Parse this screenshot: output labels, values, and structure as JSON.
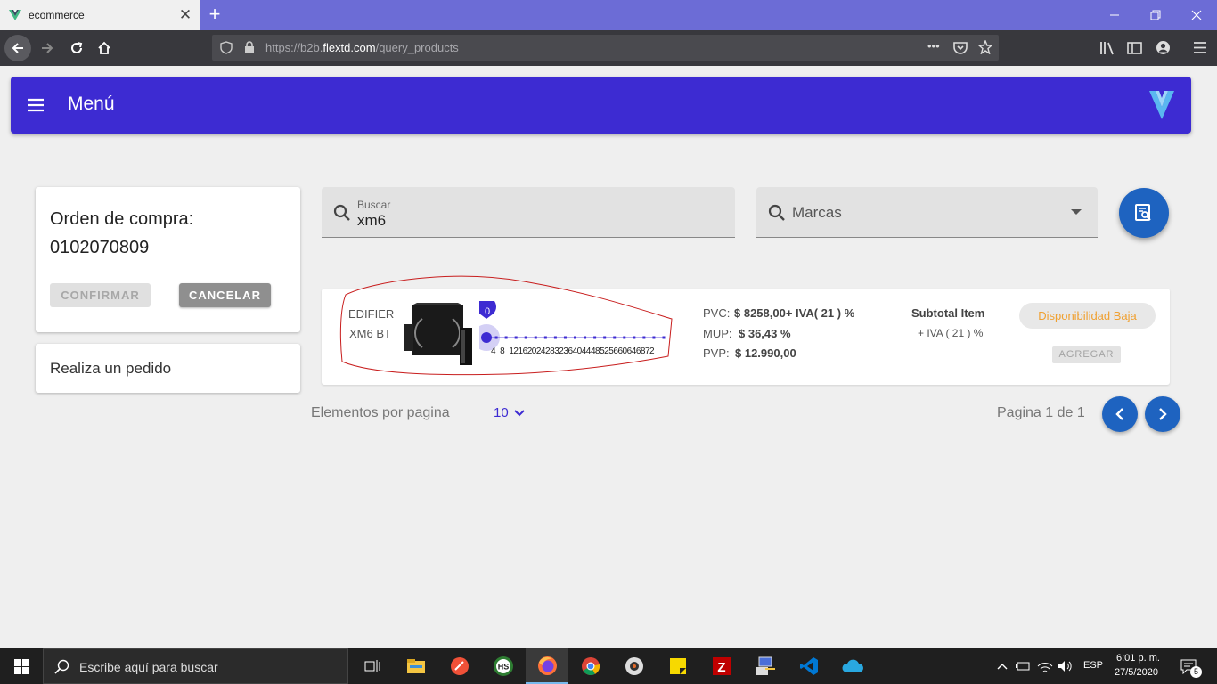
{
  "browser": {
    "tab_title": "ecommerce",
    "tab_close": "✕",
    "new_tab": "+",
    "url_prefix": "https://b2b.",
    "url_domain": "flextd.com",
    "url_path": "/query_products",
    "url_more": "•••"
  },
  "app": {
    "menu_title": "Menú",
    "accent_color": "#3d2bd2",
    "button_blue": "#1e63c0"
  },
  "order": {
    "title_line1": "Orden de compra:",
    "title_line2": "0102070809",
    "confirm_label": "CONFIRMAR",
    "cancel_label": "CANCELAR",
    "new_order_label": "Realiza un pedido"
  },
  "search": {
    "label": "Buscar",
    "value": "xm6",
    "brand_placeholder": "Marcas"
  },
  "product": {
    "brand": "EDIFIER",
    "model": "XM6 BT",
    "slider_value": "0",
    "slider_ticks": [
      "4",
      "8",
      "12",
      "16",
      "20",
      "24",
      "28",
      "32",
      "36",
      "40",
      "44",
      "48",
      "52",
      "56",
      "60",
      "64",
      "68",
      "72"
    ],
    "pvc_label": "PVC:",
    "pvc_value": "$ 8258,00+ IVA( 21 ) %",
    "mup_label": "MUP:",
    "mup_value": "$ 36,43 %",
    "pvp_label": "PVP:",
    "pvp_value": "$ 12.990,00",
    "subtotal_label": "Subtotal Item",
    "subtotal_iva": "+ IVA ( 21 ) %",
    "availability": "Disponibilidad Baja",
    "add_label": "AGREGAR"
  },
  "pagination": {
    "per_page_label": "Elementos por pagina",
    "per_page_value": "10",
    "page_label": "Pagina 1 de 1"
  },
  "taskbar": {
    "search_placeholder": "Escribe aquí para buscar",
    "lang": "ESP",
    "time": "6:01 p. m.",
    "date": "27/5/2020",
    "notif_count": "5"
  }
}
